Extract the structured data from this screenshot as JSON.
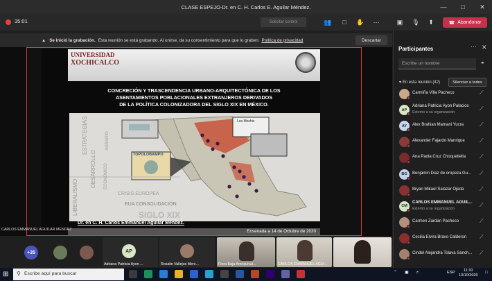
{
  "window": {
    "title": "CLASE ESPEJO-Dr. en C. H. Carlos E. Aguilar Méndez."
  },
  "toolbar": {
    "timer": "35:01",
    "request_control": "Solicitar control",
    "leave_label": "Abandonar"
  },
  "banner": {
    "bold": "Se inició la grabación.",
    "text": "Esta reunión se está grabando. Al unirse, da su consentimiento para que lo graben.",
    "link": "Política de privacidad",
    "dismiss": "Descartar"
  },
  "slide": {
    "logo_line1": "UNIVERSIDAD",
    "logo_line2": "XOCHICALCO",
    "title_lines": [
      "CONCRECIÓN Y TRASCENDENCIA URBANO-ARQUITECTÓNICA DE LOS",
      "ASENTAMIENTOS POBLACIONALES EXTRANJEROS DERIVADOS",
      "DE LA POLÍTICA COLONIZADORA DEL SIGLO XIX EN MÉXICO."
    ],
    "map_words": {
      "estrategias": "ESTRATEGIAS",
      "desarrollo": "DESARROLLO",
      "agrario": "AGRARIO",
      "economico": "ECONÓMICO",
      "liberalismo": "LIBERALISMO",
      "crisis": "CRISIS EUROPEA",
      "eua": "EUA CONSOLIDACIÓN",
      "siglo": "SIGLO XIX",
      "topolobampo": "TOPOLOBAMPO",
      "mochis": "Los Mochis"
    },
    "author": "Dr. en C. H. Carlos Emmanuel Aguilar Méndez.",
    "footer": "Ensenada a 14 de Octubre de 2020"
  },
  "presenter_label": "CARLOS EMMANUEL AGUILAR MENDEZ",
  "gallery": {
    "overflow_count": "+35",
    "tiles": [
      {
        "initials": "AP",
        "name": "Adriana Patricia Ayon ..."
      },
      {
        "name": "Rosalin Vallejos Merc..."
      },
      {
        "name": "Flora Baja Amoquivai..."
      },
      {
        "name": "CARLOS EMMANUEL AGUI..."
      }
    ]
  },
  "participants": {
    "title": "Participantes",
    "invite_placeholder": "Escribe un nombre",
    "in_meeting": "En esta reunión (42)",
    "mute_all": "Silenciar a todos",
    "list": [
      {
        "name": "Carmiña Villa Pacheco",
        "sub": "",
        "initials": "",
        "color": "#c9a98a",
        "bold": false
      },
      {
        "name": "Adriana Patricia Ayon Palacios",
        "sub": "Externo a su organización",
        "initials": "AP",
        "color": "#d9e7c5",
        "bold": false
      },
      {
        "name": "Alex Brahian Mamani Yucra",
        "sub": "",
        "initials": "AY",
        "color": "#c6d6ef",
        "bold": false
      },
      {
        "name": "Alexander Fajardo Manrique",
        "sub": "",
        "initials": "",
        "color": "#8b3a3a",
        "bold": false
      },
      {
        "name": "Ana Paola Cruz Choquetiella",
        "sub": "",
        "initials": "",
        "color": "#7a2a2a",
        "bold": false
      },
      {
        "name": "Benjamin Diaz de oropeza Gu...",
        "sub": "",
        "initials": "BG",
        "color": "#c3d0ee",
        "bold": false
      },
      {
        "name": "Bryan Mikael Salazar Ojeda",
        "sub": "",
        "initials": "",
        "color": "#8a3030",
        "bold": false
      },
      {
        "name": "CARLOS EMMANUEL AGUIL...",
        "sub": "Externo a su organización",
        "initials": "CM",
        "color": "#d5e6c2",
        "bold": true
      },
      {
        "name": "Carmen Zardan Pacheco",
        "sub": "",
        "initials": "",
        "color": "#b58f79",
        "bold": false
      },
      {
        "name": "Cecilia Elvira Bravo Calderon",
        "sub": "",
        "initials": "",
        "color": "#8a2e2e",
        "bold": false
      },
      {
        "name": "Cindel Alejandra Tolava Sanch...",
        "sub": "",
        "initials": "",
        "color": "#a3826d",
        "bold": false
      }
    ]
  },
  "taskbar": {
    "search_placeholder": "Escribe aquí para buscar",
    "lang": "ESP",
    "time": "11:10",
    "date": "13/10/2020"
  }
}
